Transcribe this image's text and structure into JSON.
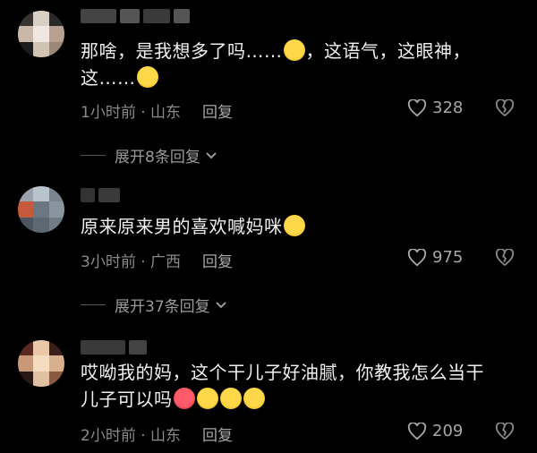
{
  "comments": [
    {
      "text_lines": [
        "那啥，是我想多了吗……",
        "这……"
      ],
      "line1_tail": "，这语气，这眼神，",
      "meta": "1小时前 · 山东",
      "reply_label": "回复",
      "likes": "328",
      "expand": "展开8条回复"
    },
    {
      "text_lines": [
        "原来原来男的喜欢喊妈咪"
      ],
      "meta": "3小时前 · 广西",
      "reply_label": "回复",
      "likes": "975",
      "expand": "展开37条回复"
    },
    {
      "text_lines": [
        "哎呦我的妈，这个干儿子好油腻，你教我怎么当干",
        "儿子可以吗"
      ],
      "meta": "2小时前 · 山东",
      "reply_label": "回复",
      "likes": "209"
    }
  ],
  "colors": {
    "background": "#000000",
    "text": "#f0f0f0",
    "meta": "#8a8a8a"
  },
  "icons": {
    "like": "heart-outline-icon",
    "dislike": "broken-heart-icon",
    "expand": "chevron-down-icon"
  }
}
